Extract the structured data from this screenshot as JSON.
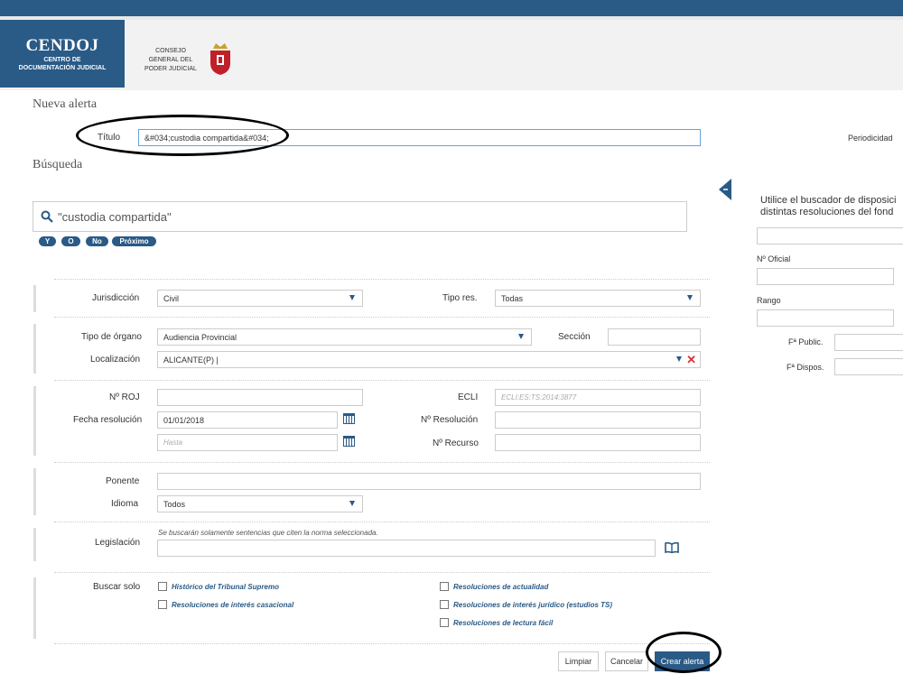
{
  "header": {
    "logo_title": "CENDOJ",
    "logo_sub1": "CENTRO DE",
    "logo_sub2": "DOCUMENTACIÓN JUDICIAL",
    "org_line1": "CONSEJO",
    "org_line2": "GENERAL DEL",
    "org_line3": "PODER JUDICIAL"
  },
  "alert": {
    "heading": "Nueva alerta",
    "title_label": "Título",
    "title_value": "&#034;custodia compartida&#034;",
    "periodicity_label": "Periodicidad"
  },
  "search": {
    "heading": "Búsqueda",
    "query": "\"custodia compartida\"",
    "operators": [
      "Y",
      "O",
      "No",
      "Próximo"
    ]
  },
  "form": {
    "jurisdiccion_label": "Jurisdicción",
    "jurisdiccion_value": "Civil",
    "tipo_res_label": "Tipo res.",
    "tipo_res_value": "Todas",
    "tipo_organo_label": "Tipo de órgano",
    "tipo_organo_value": "Audiencia Provincial",
    "seccion_label": "Sección",
    "localizacion_label": "Localización",
    "localizacion_value": "ALICANTE(P) |",
    "nrojl_label": "Nº ROJ",
    "ecli_label": "ECLI",
    "ecli_placeholder": "ECLI:ES:TS:2014:3877",
    "fecha_label": "Fecha resolución",
    "fecha_desde": "01/01/2018",
    "fecha_hasta_placeholder": "Hasta",
    "nresolucion_label": "Nº Resolución",
    "nrecurso_label": "Nº Recurso",
    "ponente_label": "Ponente",
    "idioma_label": "Idioma",
    "idioma_value": "Todos",
    "legislacion_label": "Legislación",
    "legislacion_hint": "Se buscarán solamente sentencias que citen la norma seleccionada.",
    "buscar_solo_label": "Buscar solo",
    "checks": {
      "historico": "Histórico del Tribunal Supremo",
      "casacional": "Resoluciones de interés casacional",
      "actualidad": "Resoluciones de actualidad",
      "juridico": "Resoluciones de interés jurídico (estudios TS)",
      "lectura": "Resoluciones de lectura fácil"
    }
  },
  "buttons": {
    "limpiar": "Limpiar",
    "cancelar": "Cancelar",
    "crear": "Crear alerta"
  },
  "side": {
    "text_line1": "Utilice el buscador de disposici",
    "text_line2": "distintas resoluciones del fond",
    "oficial_label": "Nº Oficial",
    "rango_label": "Rango",
    "public_label": "Fª Public.",
    "dispos_label": "Fª Dispos."
  },
  "colors": {
    "primary": "#2a5a86",
    "danger": "#d9302c"
  }
}
